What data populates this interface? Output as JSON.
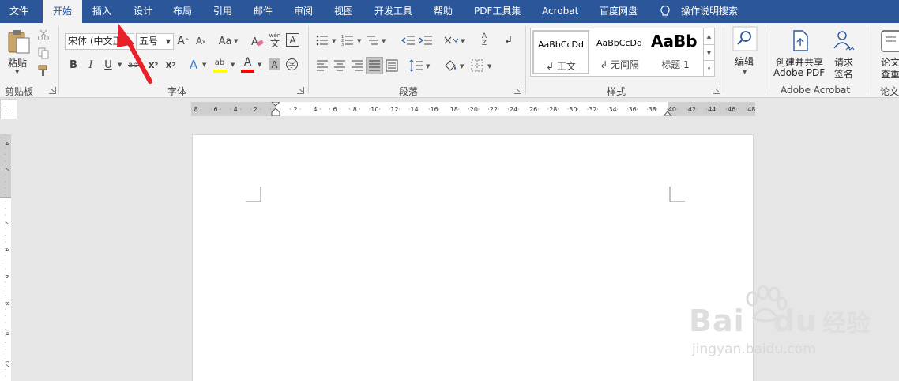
{
  "tabs": [
    {
      "label": "文件"
    },
    {
      "label": "开始"
    },
    {
      "label": "插入"
    },
    {
      "label": "设计"
    },
    {
      "label": "布局"
    },
    {
      "label": "引用"
    },
    {
      "label": "邮件"
    },
    {
      "label": "审阅"
    },
    {
      "label": "视图"
    },
    {
      "label": "开发工具"
    },
    {
      "label": "帮助"
    },
    {
      "label": "PDF工具集"
    },
    {
      "label": "Acrobat"
    },
    {
      "label": "百度网盘"
    }
  ],
  "tell_me": "操作说明搜索",
  "clipboard": {
    "paste_label": "粘贴",
    "group_label": "剪贴板"
  },
  "font": {
    "name": "宋体 (中文正",
    "size": "五号",
    "group_label": "字体",
    "case_label": "Aa",
    "phonetic_label": "wén"
  },
  "paragraph": {
    "group_label": "段落"
  },
  "styles": {
    "group_label": "样式",
    "items": [
      {
        "sample": "AaBbCcDd",
        "name": "↲ 正文"
      },
      {
        "sample": "AaBbCcDd",
        "name": "↲ 无间隔"
      },
      {
        "sample": "AaBb",
        "name": "标题 1"
      }
    ]
  },
  "editing": {
    "label": "编辑"
  },
  "acrobat": {
    "create_label": "创建并共享",
    "create_label2": "Adobe PDF",
    "sign_label": "请求",
    "sign_label2": "签名",
    "group_label": "Adobe Acrobat"
  },
  "paper": {
    "label": "论文",
    "label2": "查重",
    "group_label": "论文"
  },
  "ruler": {
    "h_labels": [
      "8",
      "6",
      "4",
      "2",
      "2",
      "4",
      "6",
      "8",
      "10",
      "12",
      "14",
      "16",
      "18",
      "20",
      "22",
      "24",
      "26",
      "28",
      "30",
      "32",
      "34",
      "36",
      "38",
      "40",
      "42",
      "44",
      "46",
      "48"
    ],
    "v_labels": [
      "4",
      "2",
      "2",
      "4",
      "6",
      "8",
      "10",
      "12"
    ]
  },
  "watermark": {
    "brand": "Bai",
    "brand2": "du",
    "product": "经验",
    "url": "jingyan.baidu.com"
  },
  "colors": {
    "accent": "#2b579a",
    "highlight": "#ffff00",
    "font_color": "#ff0000",
    "arrow": "#e8202a"
  }
}
